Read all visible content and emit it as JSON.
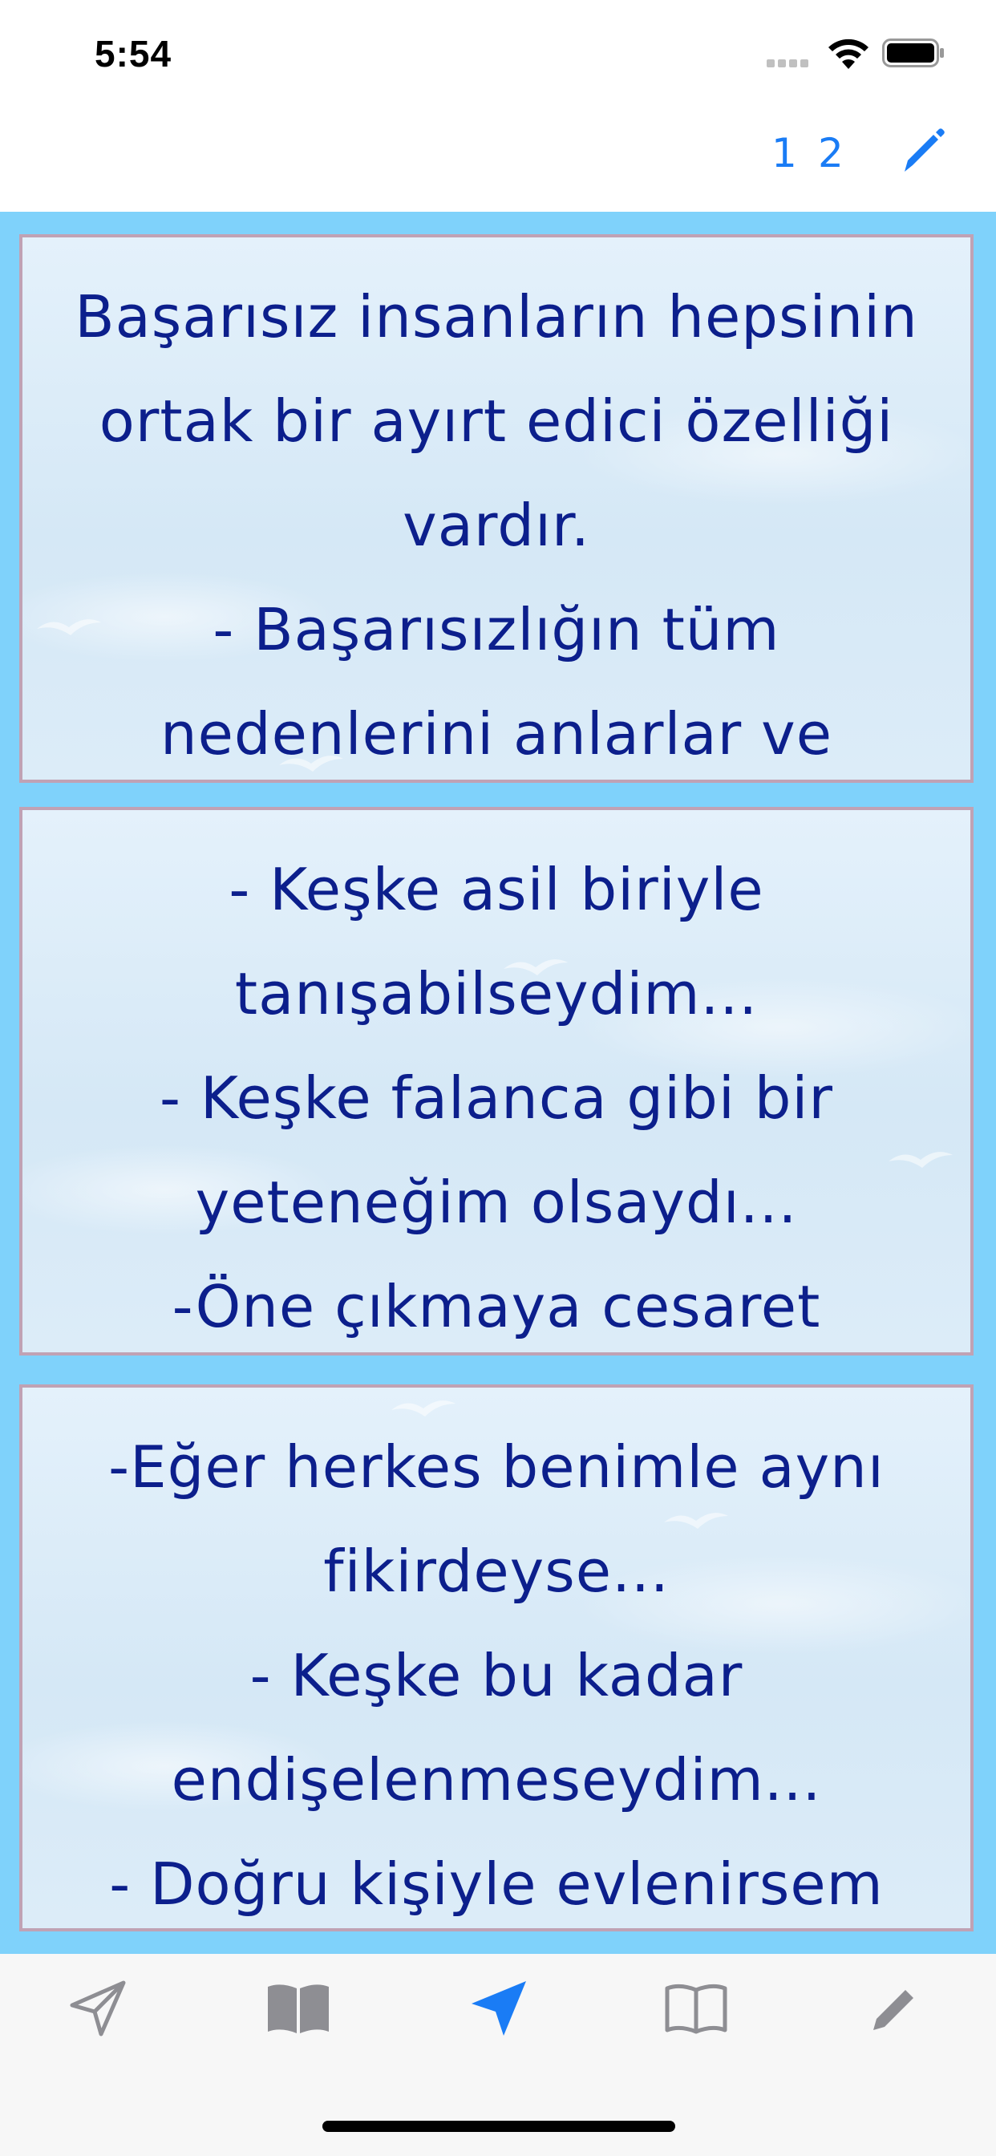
{
  "status_bar": {
    "time": "5:54"
  },
  "nav_bar": {
    "page_one_label": "1",
    "page_two_label": "2",
    "edit_icon": "pencil-icon"
  },
  "colors": {
    "accent": "#1a7cf5",
    "content_background": "#7fd2fb",
    "text": "#0c1f8c",
    "card_border": "#c0a2b4",
    "tab_inactive": "#8e8e93"
  },
  "cards": [
    {
      "lines": [
        "Başarısız insanların hepsinin",
        "ortak bir ayırt edici özelliği",
        "vardır.",
        "- Başarısızlığın tüm",
        "nedenlerini anlarlar ve"
      ]
    },
    {
      "lines": [
        "- Keşke asil biriyle",
        "tanışabilseydim...",
        "- Keşke falanca gibi bir",
        "yeteneğim olsaydı...",
        "-Öne çıkmaya cesaret"
      ]
    },
    {
      "lines": [
        "-Eğer herkes benimle aynı",
        "fikirdeyse...",
        "- Keşke bu kadar",
        "endişelenmeseydim...",
        "- Doğru kişiyle evlenirsem"
      ]
    }
  ],
  "tab_bar": {
    "tabs": [
      {
        "icon": "paper-plane-outline-icon",
        "selected": false
      },
      {
        "icon": "book-filled-icon",
        "selected": false
      },
      {
        "icon": "paper-plane-filled-icon",
        "selected": true
      },
      {
        "icon": "book-outline-icon",
        "selected": false
      },
      {
        "icon": "pencil-icon",
        "selected": false
      }
    ]
  }
}
